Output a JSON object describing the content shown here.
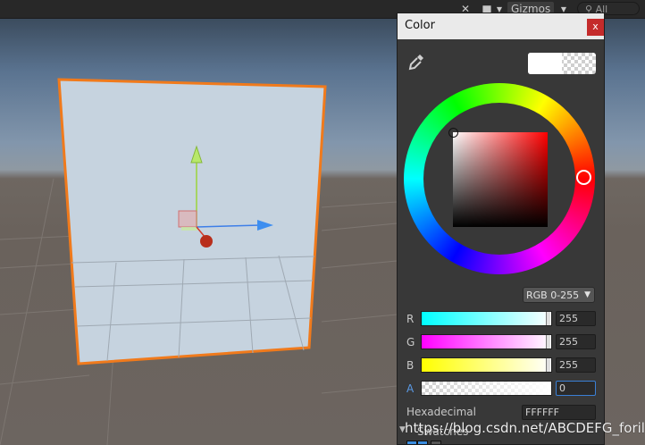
{
  "scene": {
    "toolbar": {
      "gizmos_label": "Gizmos",
      "search_placeholder": "All"
    },
    "selection_color": "#f07a1c",
    "plane_color": "#c6d3df"
  },
  "color_window": {
    "title": "Color",
    "close_label": "x",
    "current_color": "#ffffff",
    "mode_label": "RGB 0-255",
    "channels": [
      {
        "label": "R",
        "value": "255"
      },
      {
        "label": "G",
        "value": "255"
      },
      {
        "label": "B",
        "value": "255"
      },
      {
        "label": "A",
        "value": "0"
      }
    ],
    "hex_label": "Hexadecimal",
    "hex_value": "FFFFFF",
    "swatches_label": "Swatches"
  },
  "watermark": "https://blog.csdn.net/ABCDEFG_forill"
}
